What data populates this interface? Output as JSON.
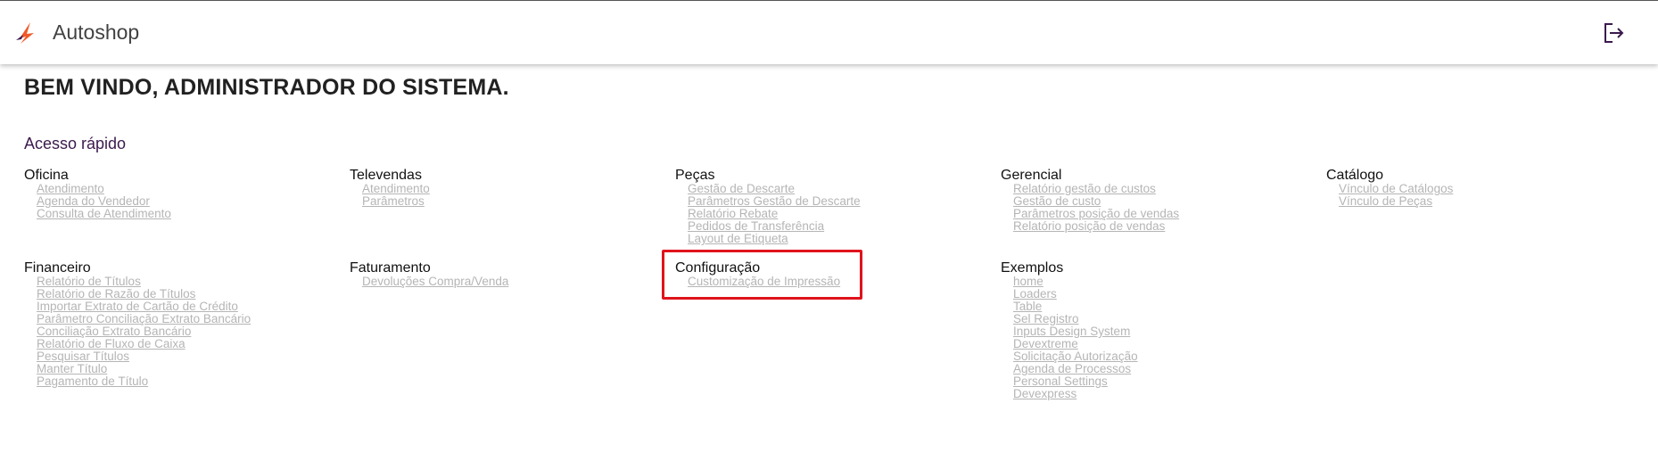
{
  "header": {
    "app_title": "Autoshop",
    "logout_icon": "logout-icon",
    "brand_color": "#f05a28"
  },
  "welcome": "BEM VINDO, ADMINISTRADOR DO SISTEMA.",
  "quick_access_title": "Acesso rápido",
  "groups": [
    {
      "title": "Oficina",
      "links": [
        "Atendimento",
        "Agenda do Vendedor",
        "Consulta de Atendimento"
      ]
    },
    {
      "title": "Televendas",
      "links": [
        "Atendimento",
        "Parâmetros"
      ]
    },
    {
      "title": "Peças",
      "links": [
        "Gestão de Descarte",
        "Parâmetros Gestão de Descarte",
        "Relatório Rebate",
        "Pedidos de Transferência",
        "Layout de Etiqueta"
      ]
    },
    {
      "title": "Gerencial",
      "links": [
        "Relatório gestão de custos",
        "Gestão de custo",
        "Parâmetros posição de vendas",
        "Relatório posição de vendas"
      ]
    },
    {
      "title": "Catálogo",
      "links": [
        "Vínculo de Catálogos",
        "Vínculo de Peças"
      ]
    },
    {
      "title": "Financeiro",
      "links": [
        "Relatório de Títulos",
        "Relatório de Razão de Títulos",
        "Importar Extrato de Cartão de Crédito",
        "Parâmetro Conciliação Extrato Bancário",
        "Conciliação Extrato Bancário",
        "Relatório de Fluxo de Caixa",
        "Pesquisar Títulos",
        "Manter Título",
        "Pagamento de Título"
      ]
    },
    {
      "title": "Faturamento",
      "links": [
        "Devoluções Compra/Venda"
      ]
    },
    {
      "title": "Configuração",
      "links": [
        "Customização de Impressão"
      ]
    },
    {
      "title": "Exemplos",
      "links": [
        "home",
        "Loaders",
        "Table",
        "Sel Registro",
        "Inputs Design System",
        "Devextreme",
        "Solicitação Autorização",
        "Agenda de Processos",
        "Personal Settings",
        "Devexpress"
      ]
    }
  ],
  "highlight_color": "#e0121b"
}
